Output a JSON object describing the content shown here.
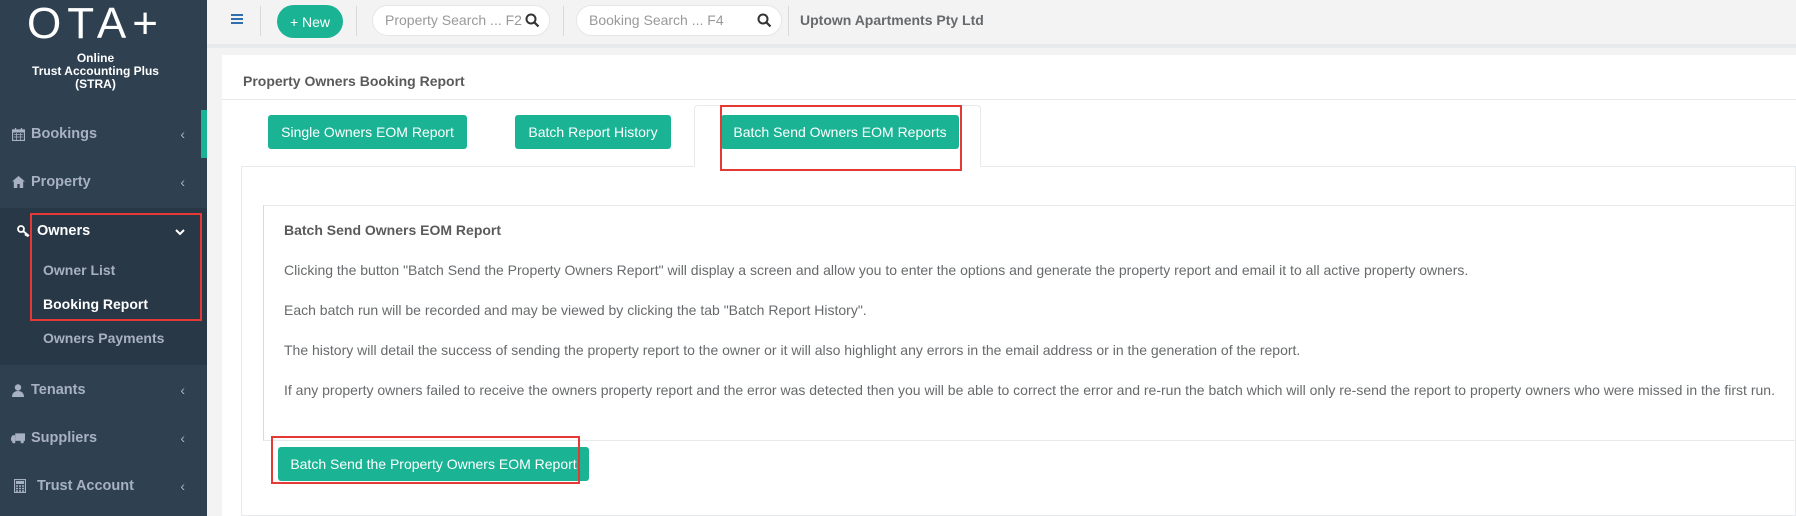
{
  "app": {
    "logo_title": "OTA+",
    "logo_line1": "Online",
    "logo_line2": "Trust Accounting Plus",
    "logo_line3": "(STRA)"
  },
  "sidebar": {
    "items": [
      {
        "label": "Bookings",
        "icon": "calendar-icon"
      },
      {
        "label": "Property",
        "icon": "home-icon"
      },
      {
        "label": "Owners",
        "icon": "key-icon"
      },
      {
        "label": "Tenants",
        "icon": "user-icon"
      },
      {
        "label": "Suppliers",
        "icon": "truck-icon"
      },
      {
        "label": "Trust Account",
        "icon": "calculator-icon"
      }
    ],
    "owners_sub": [
      {
        "label": "Owner List"
      },
      {
        "label": "Booking Report"
      },
      {
        "label": "Owners Payments"
      }
    ],
    "accent": "#1ab394"
  },
  "topbar": {
    "new_label": "+ New",
    "property_search_placeholder": "Property Search ... F2",
    "booking_search_placeholder": "Booking Search ... F4",
    "company": "Uptown Apartments Pty Ltd"
  },
  "page": {
    "title": "Property Owners Booking Report",
    "tabs": [
      {
        "label": "Single Owners EOM Report"
      },
      {
        "label": "Batch Report History"
      },
      {
        "label": "Batch Send Owners EOM Reports",
        "active": true
      }
    ],
    "section_title": "Batch Send Owners EOM Report",
    "paragraphs": [
      "Clicking the button \"Batch Send the Property Owners Report\" will display a screen and allow you to enter the options and generate the property report and email it to all active property owners.",
      "Each batch run will be recorded and may be viewed by clicking the tab \"Batch Report History\".",
      "The history will detail the success of sending the property report to the owner or it will also highlight any errors in the email address or in the generation of the report.",
      "If any property owners failed to receive the owners property report and the error was detected then you will be able to correct the error and re-run the batch which will only re-send the report to property owners who were missed in the first run."
    ],
    "action_button": "Batch Send the Property Owners EOM Report"
  },
  "colors": {
    "sidebar_bg": "#2f4050",
    "primary": "#1ab394",
    "highlight": "#e53935"
  }
}
